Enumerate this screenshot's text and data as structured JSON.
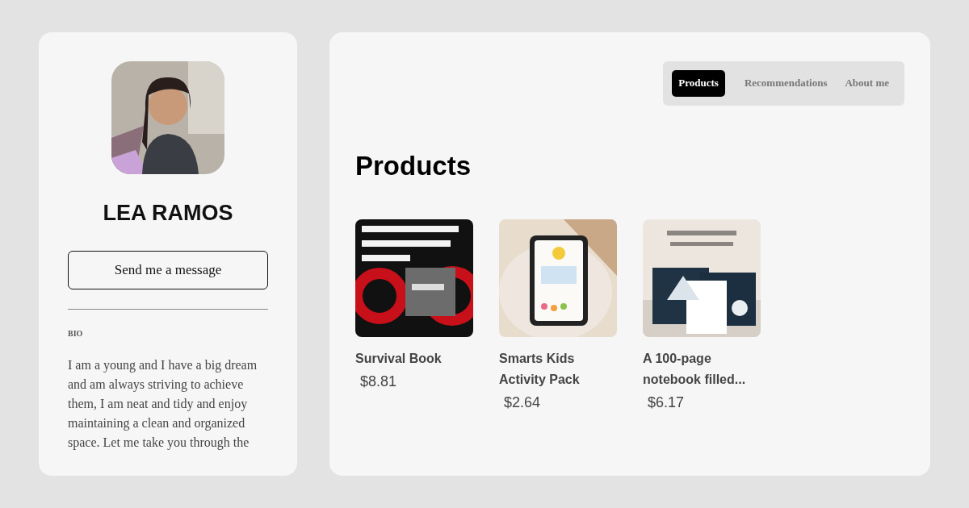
{
  "profile": {
    "name": "LEA RAMOS",
    "message_button": "Send me a message",
    "bio_heading": "BIO",
    "bio": "I am a young and I have a big dream and am always striving to achieve them, I am neat and tidy and enjoy maintaining a clean and organized space. Let me take you through the"
  },
  "tabs": [
    {
      "label": "Products",
      "selected": true
    },
    {
      "label": "Recommendations",
      "selected": false
    },
    {
      "label": "About me",
      "selected": false
    }
  ],
  "heading": "Products",
  "products": [
    {
      "title": "Survival Book",
      "price": "$8.81"
    },
    {
      "title": "Smarts Kids Activity Pack",
      "price": "$2.64"
    },
    {
      "title": "A 100-page notebook filled...",
      "price": "$6.17"
    }
  ]
}
